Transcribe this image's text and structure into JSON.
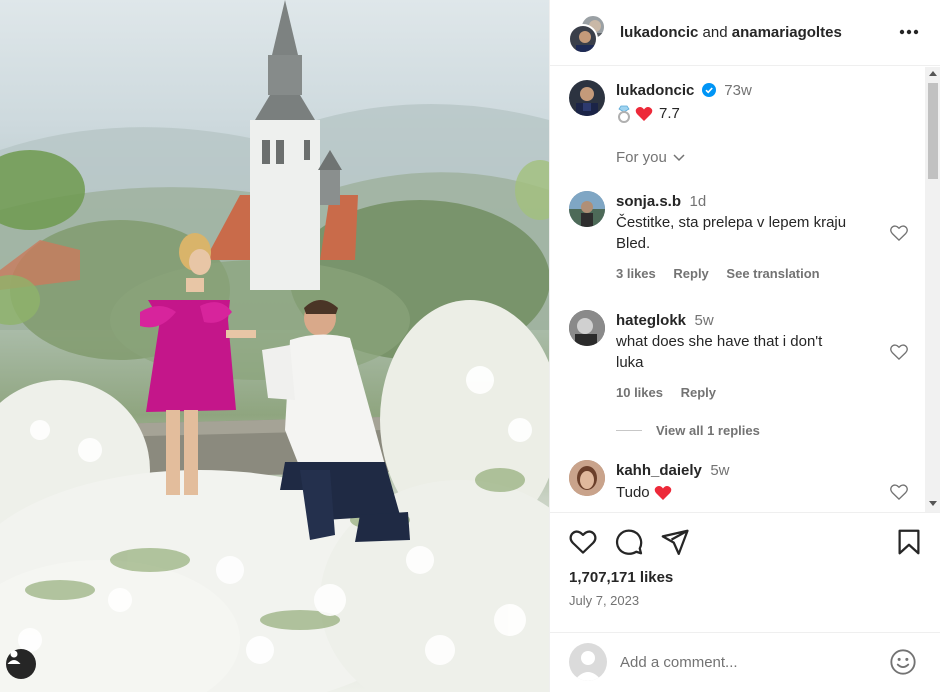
{
  "header": {
    "user1": "lukadoncic",
    "joiner": "and",
    "user2": "anamariagoltes",
    "more_icon": "more-horizontal-icon"
  },
  "caption": {
    "username": "lukadoncic",
    "verified_icon": "verified-badge-icon",
    "time": "73w",
    "text": "7.7",
    "emojis": [
      "ring-emoji",
      "red-heart-emoji"
    ]
  },
  "for_you": {
    "label": "For you",
    "icon": "chevron-down-icon"
  },
  "comments": [
    {
      "username": "sonja.s.b",
      "time": "1d",
      "text_line1": "Čestitke, sta prelepa v lepem kraju",
      "text_line2": "Bled.",
      "likes": "3 likes",
      "reply": "Reply",
      "translate": "See translation"
    },
    {
      "username": "hateglokk",
      "time": "5w",
      "text_line1": "what does she have that i don't",
      "text_line2": "luka",
      "likes": "10 likes",
      "reply": "Reply",
      "view_replies": "View all 1 replies"
    },
    {
      "username": "kahh_daiely",
      "time": "5w",
      "text": "Tudo"
    }
  ],
  "actions": {
    "like_icon": "heart-icon",
    "comment_icon": "comment-icon",
    "share_icon": "send-icon",
    "save_icon": "bookmark-icon",
    "likes": "1,707,171 likes",
    "date": "July 7, 2023"
  },
  "add_comment": {
    "placeholder": "Add a comment...",
    "emoji_icon": "emoji-icon"
  },
  "colors": {
    "verified": "#0095f6",
    "heart_red": "#ed2939",
    "secondary_text": "#737373",
    "dress_pink": "#c4168a"
  }
}
